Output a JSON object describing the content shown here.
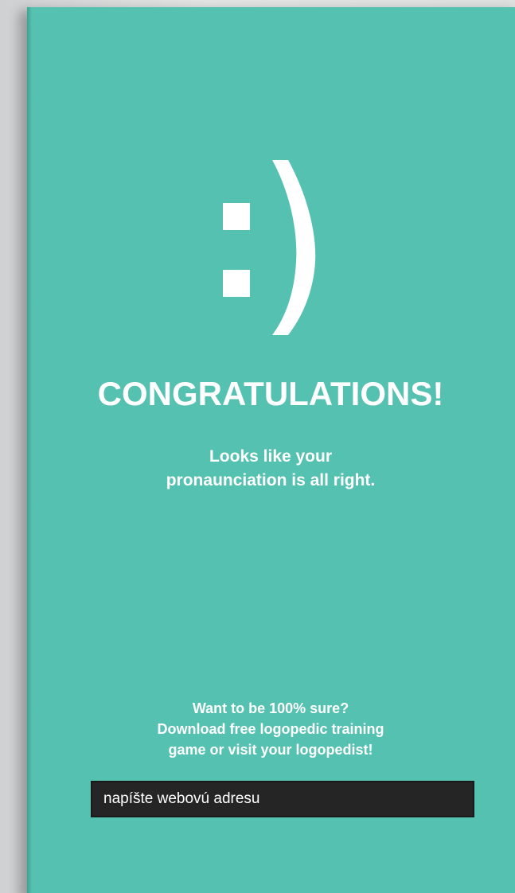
{
  "card": {
    "background_color": "#55c1b0",
    "smiley_icon": "smiley-emoticon-icon",
    "title": "CONGRATULATIONS!",
    "subtitle_line1": "Looks like your",
    "subtitle_line2": "pronaunciation is all right.",
    "cta_line1": "Want to be 100% sure?",
    "cta_line2": "Download free logopedic training",
    "cta_line3": "game or visit your logopedist!",
    "url_input": {
      "placeholder": "napíšte webovú adresu",
      "value": "napíšte webovú adresu"
    }
  }
}
